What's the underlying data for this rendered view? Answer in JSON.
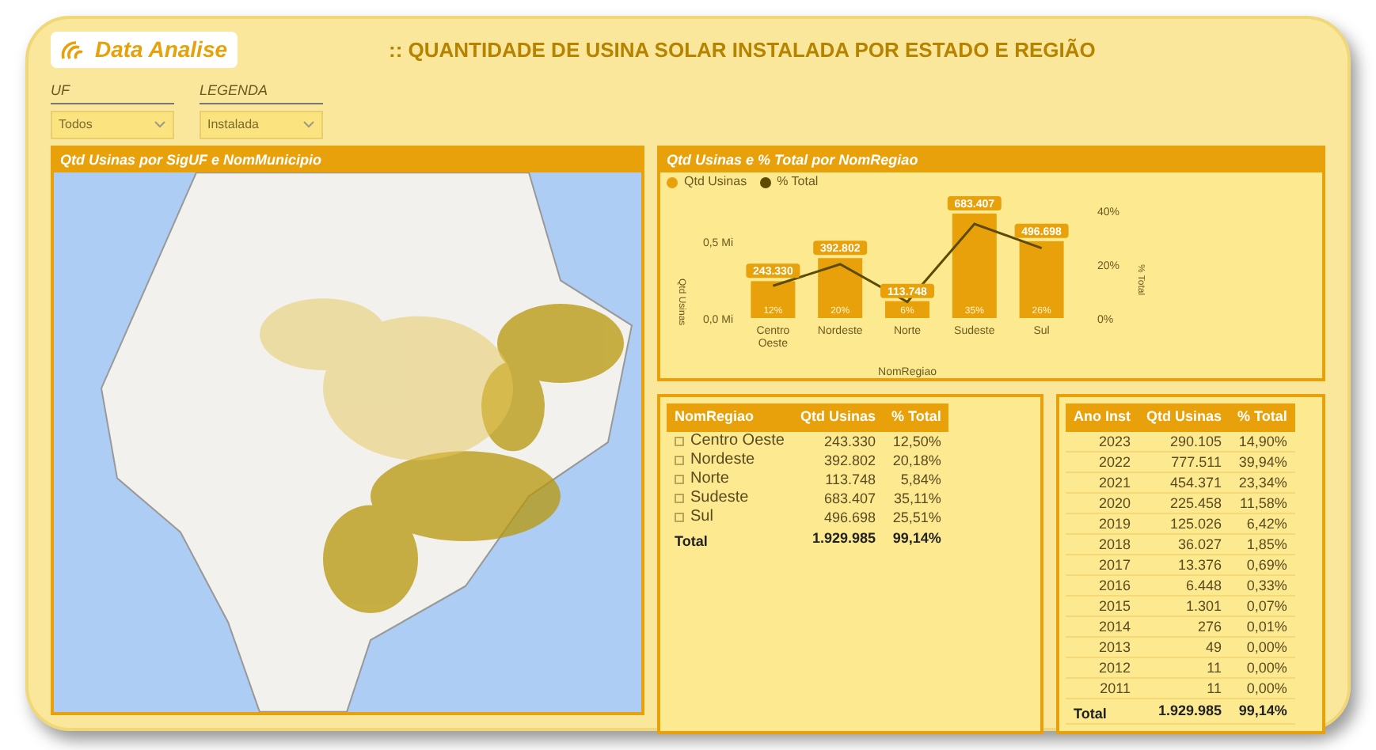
{
  "header": {
    "logo": "Data Analise",
    "title": ":: QUANTIDADE DE USINA SOLAR INSTALADA POR ESTADO E REGIÃO"
  },
  "filters": [
    {
      "label": "UF",
      "value": "Todos"
    },
    {
      "label": "LEGENDA",
      "value": "Instalada"
    }
  ],
  "map_panel": {
    "title": "Qtd Usinas por SigUF e NomMunicipio"
  },
  "chart_panel": {
    "title": "Qtd Usinas e % Total por NomRegiao",
    "bar_chart": {
      "chart_data": {
        "type": "bar",
        "xlabel": "NomRegiao",
        "ylabel": "Qtd Usinas",
        "categories": [
          "Centro Oeste",
          "Nordeste",
          "Norte",
          "Sudeste",
          "Sul"
        ],
        "series": [
          {
            "name": "Qtd Usinas",
            "color": "#e8a10a",
            "values": [
              0.24,
              0.39,
              0.11,
              0.68,
              0.5
            ]
          }
        ],
        "ylim": [
          0,
          0.7
        ],
        "yticks": [
          {
            "value": 0,
            "label": "0,0 Mi"
          },
          {
            "value": 0.5,
            "label": "0,5 Mi"
          }
        ],
        "value_labels": [
          [
            "243.330",
            "392.802",
            "113.748",
            "683.407",
            "496.698"
          ]
        ]
      }
    },
    "line_chart": {
      "chart_data": {
        "type": "line",
        "ylabel": "% Total",
        "series": [
          {
            "name": "% Total",
            "color": "#5c4b00",
            "values": [
              12,
              20,
              6,
              35,
              26
            ]
          }
        ],
        "ylim": [
          0,
          40
        ],
        "yticks": [
          {
            "value": 0,
            "label": "0%"
          },
          {
            "value": 20,
            "label": "20%"
          },
          {
            "value": 40,
            "label": "40%"
          }
        ],
        "value_labels": [
          [
            "12%",
            "20%",
            "6%",
            "35%",
            "26%"
          ]
        ]
      }
    }
  },
  "region_table": {
    "columns": [
      "NomRegiao",
      "Qtd Usinas",
      "% Total"
    ],
    "rows": [
      {
        "cells": [
          "Centro Oeste",
          "243.330",
          "12,50%"
        ]
      },
      {
        "cells": [
          "Nordeste",
          "392.802",
          "20,18%"
        ]
      },
      {
        "cells": [
          "Norte",
          "113.748",
          "5,84%"
        ]
      },
      {
        "cells": [
          "Sudeste",
          "683.407",
          "35,11%"
        ]
      },
      {
        "cells": [
          "Sul",
          "496.698",
          "25,51%"
        ]
      }
    ],
    "total": [
      "Total",
      "1.929.985",
      "99,14%"
    ]
  },
  "year_table": {
    "columns": [
      "Ano Inst",
      "Qtd Usinas",
      "% Total"
    ],
    "rows": [
      [
        "2023",
        "290.105",
        "14,90%"
      ],
      [
        "2022",
        "777.511",
        "39,94%"
      ],
      [
        "2021",
        "454.371",
        "23,34%"
      ],
      [
        "2020",
        "225.458",
        "11,58%"
      ],
      [
        "2019",
        "125.026",
        "6,42%"
      ],
      [
        "2018",
        "36.027",
        "1,85%"
      ],
      [
        "2017",
        "13.376",
        "0,69%"
      ],
      [
        "2016",
        "6.448",
        "0,33%"
      ],
      [
        "2015",
        "1.301",
        "0,07%"
      ],
      [
        "2014",
        "276",
        "0,01%"
      ],
      [
        "2013",
        "49",
        "0,00%"
      ],
      [
        "2012",
        "11",
        "0,00%"
      ],
      [
        "2011",
        "11",
        "0,00%"
      ]
    ],
    "total": [
      "Total",
      "1.929.985",
      "99,14%"
    ]
  }
}
